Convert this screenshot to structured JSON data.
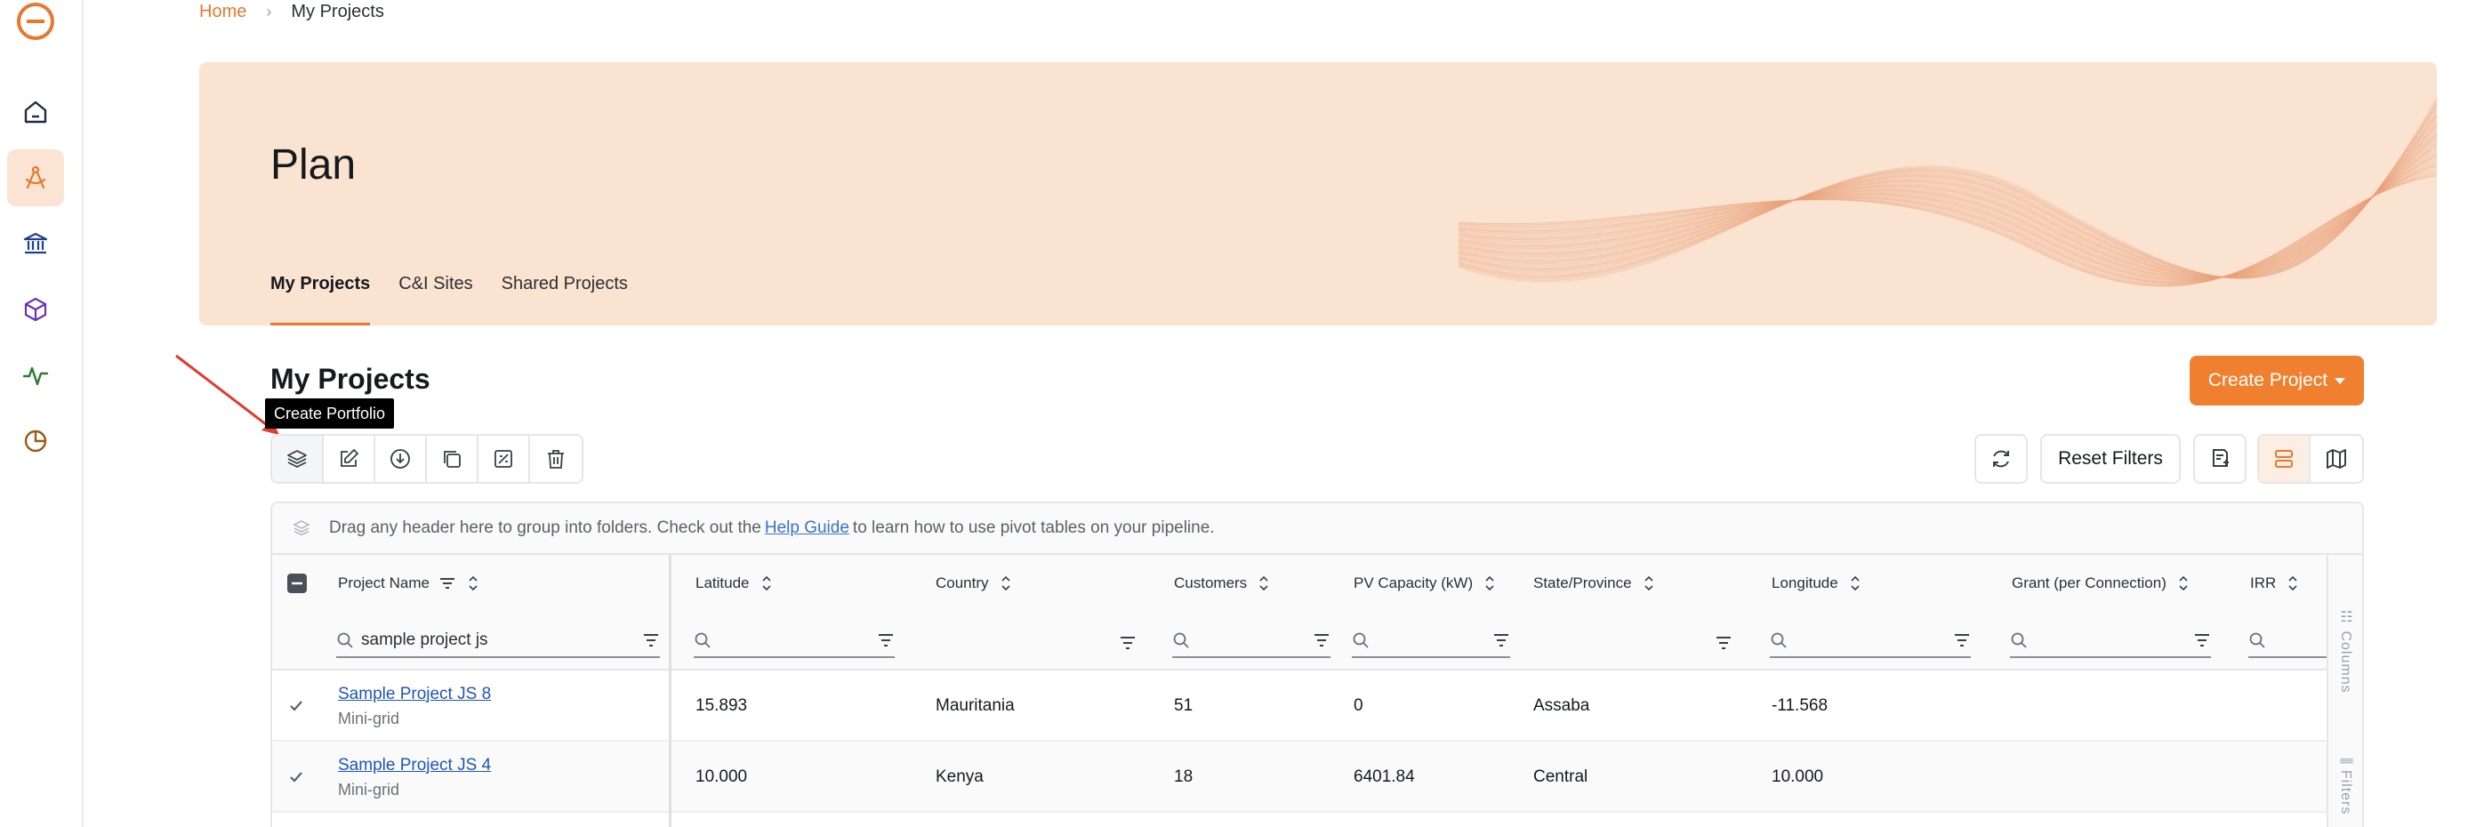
{
  "breadcrumb": {
    "home": "Home",
    "current": "My Projects"
  },
  "hero": {
    "title": "Plan",
    "tabs": [
      {
        "label": "My Projects",
        "active": true
      },
      {
        "label": "C&I Sites",
        "active": false
      },
      {
        "label": "Shared Projects",
        "active": false
      }
    ]
  },
  "section": {
    "title": "My Projects",
    "create_button": "Create Project"
  },
  "tooltip": "Create Portfolio",
  "toolbar": {
    "reset_filters": "Reset Filters"
  },
  "grid": {
    "group_bar": {
      "before": "Drag any header here to group into folders. Check out the",
      "link": "Help Guide",
      "after": "to learn how to use pivot tables on your pipeline."
    },
    "columns": [
      "Project Name",
      "Latitude",
      "Country",
      "Customers",
      "PV Capacity (kW)",
      "State/Province",
      "Longitude",
      "Grant (per Connection)",
      "IRR"
    ],
    "name_filter_value": "sample project js",
    "rows": [
      {
        "name": "Sample Project JS 8",
        "type": "Mini-grid",
        "latitude": "15.893",
        "country": "Mauritania",
        "customers": "51",
        "pv": "0",
        "state": "Assaba",
        "longitude": "-11.568"
      },
      {
        "name": "Sample Project JS 4",
        "type": "Mini-grid",
        "latitude": "10.000",
        "country": "Kenya",
        "customers": "18",
        "pv": "6401.84",
        "state": "Central",
        "longitude": "10.000"
      }
    ],
    "side_panel": {
      "columns": "Columns",
      "filters": "Filters"
    }
  },
  "colors": {
    "accent": "#f0802f",
    "hero_bg": "#fbe3d1",
    "link": "#1f56b5"
  }
}
